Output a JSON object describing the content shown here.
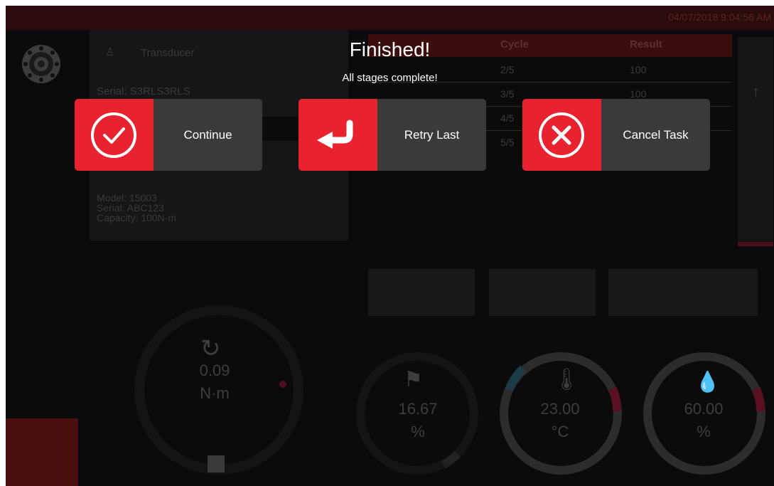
{
  "datetime": "04/07/2018 9:04:56 AM",
  "transducer": {
    "label": "Transducer",
    "serial": "Serial: S3RLS3RLS"
  },
  "tool": {
    "model": "Model: 15003",
    "serial": "Serial: ABC123",
    "capacity": "Capacity: 100N·m"
  },
  "table": {
    "headers": [
      "Cycle",
      "Result"
    ],
    "rows": [
      {
        "cycle": "2/5",
        "result": "100"
      },
      {
        "cycle": "3/5",
        "result": "100"
      },
      {
        "cycle": "4/5",
        "result": ""
      },
      {
        "cycle": "5/5",
        "result": ""
      }
    ]
  },
  "gauges": {
    "torque": {
      "value": "0.09",
      "unit": "N·m"
    },
    "progress": {
      "value": "16.67",
      "unit": "%"
    },
    "temperature": {
      "value": "23.00",
      "unit": "°C"
    },
    "humidity": {
      "value": "60.00",
      "unit": "%"
    }
  },
  "modal": {
    "title": "Finished!",
    "subtitle": "All stages complete!",
    "continue_label": "Continue",
    "retry_label": "Retry Last",
    "cancel_label": "Cancel Task"
  },
  "colors": {
    "accent": "#e8232f",
    "button_bg": "#3a3a3a",
    "overlay_bg": "#0b0b0b"
  },
  "icons": {
    "continue": "check-circle-icon",
    "retry": "return-arrow-icon",
    "cancel": "x-circle-icon",
    "settings": "gear-icon"
  }
}
